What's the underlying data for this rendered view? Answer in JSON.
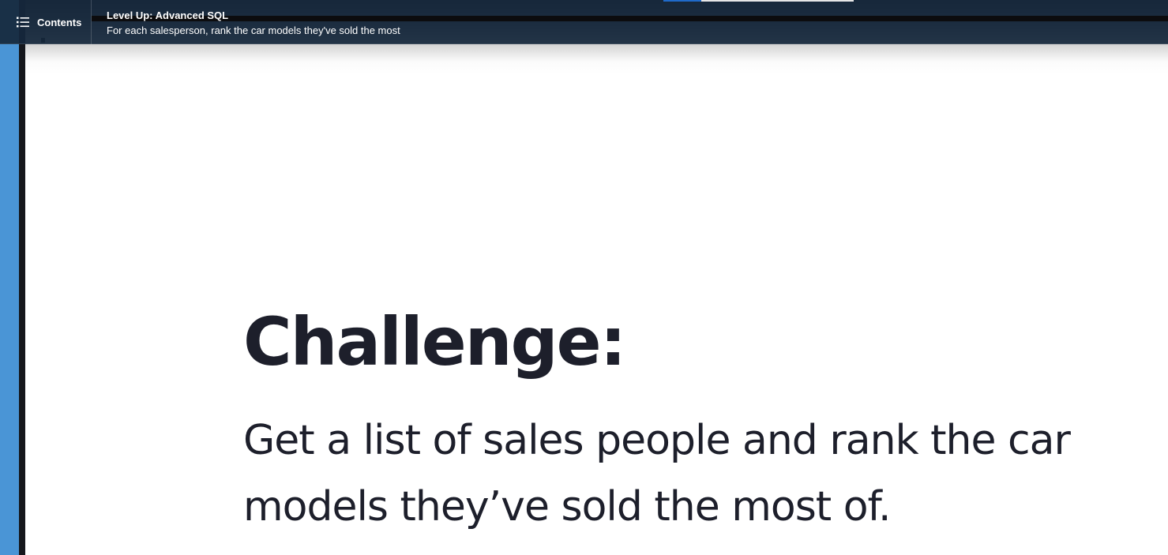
{
  "header": {
    "contents_label": "Contents",
    "course_title": "Level Up: Advanced SQL",
    "video_title": "For each salesperson, rank the car models they've sold the most",
    "progress_fraction": 0.2
  },
  "slide": {
    "heading": "Challenge:",
    "body": "Get a list of sales people and rank the car models they’ve sold the most of."
  },
  "colors": {
    "header_bg": "#16283c",
    "left_rail": "#4a95d6",
    "progress_fill": "#1f6ac9",
    "slide_text": "#1d1f2b"
  },
  "icons": {
    "contents": "list-icon"
  }
}
